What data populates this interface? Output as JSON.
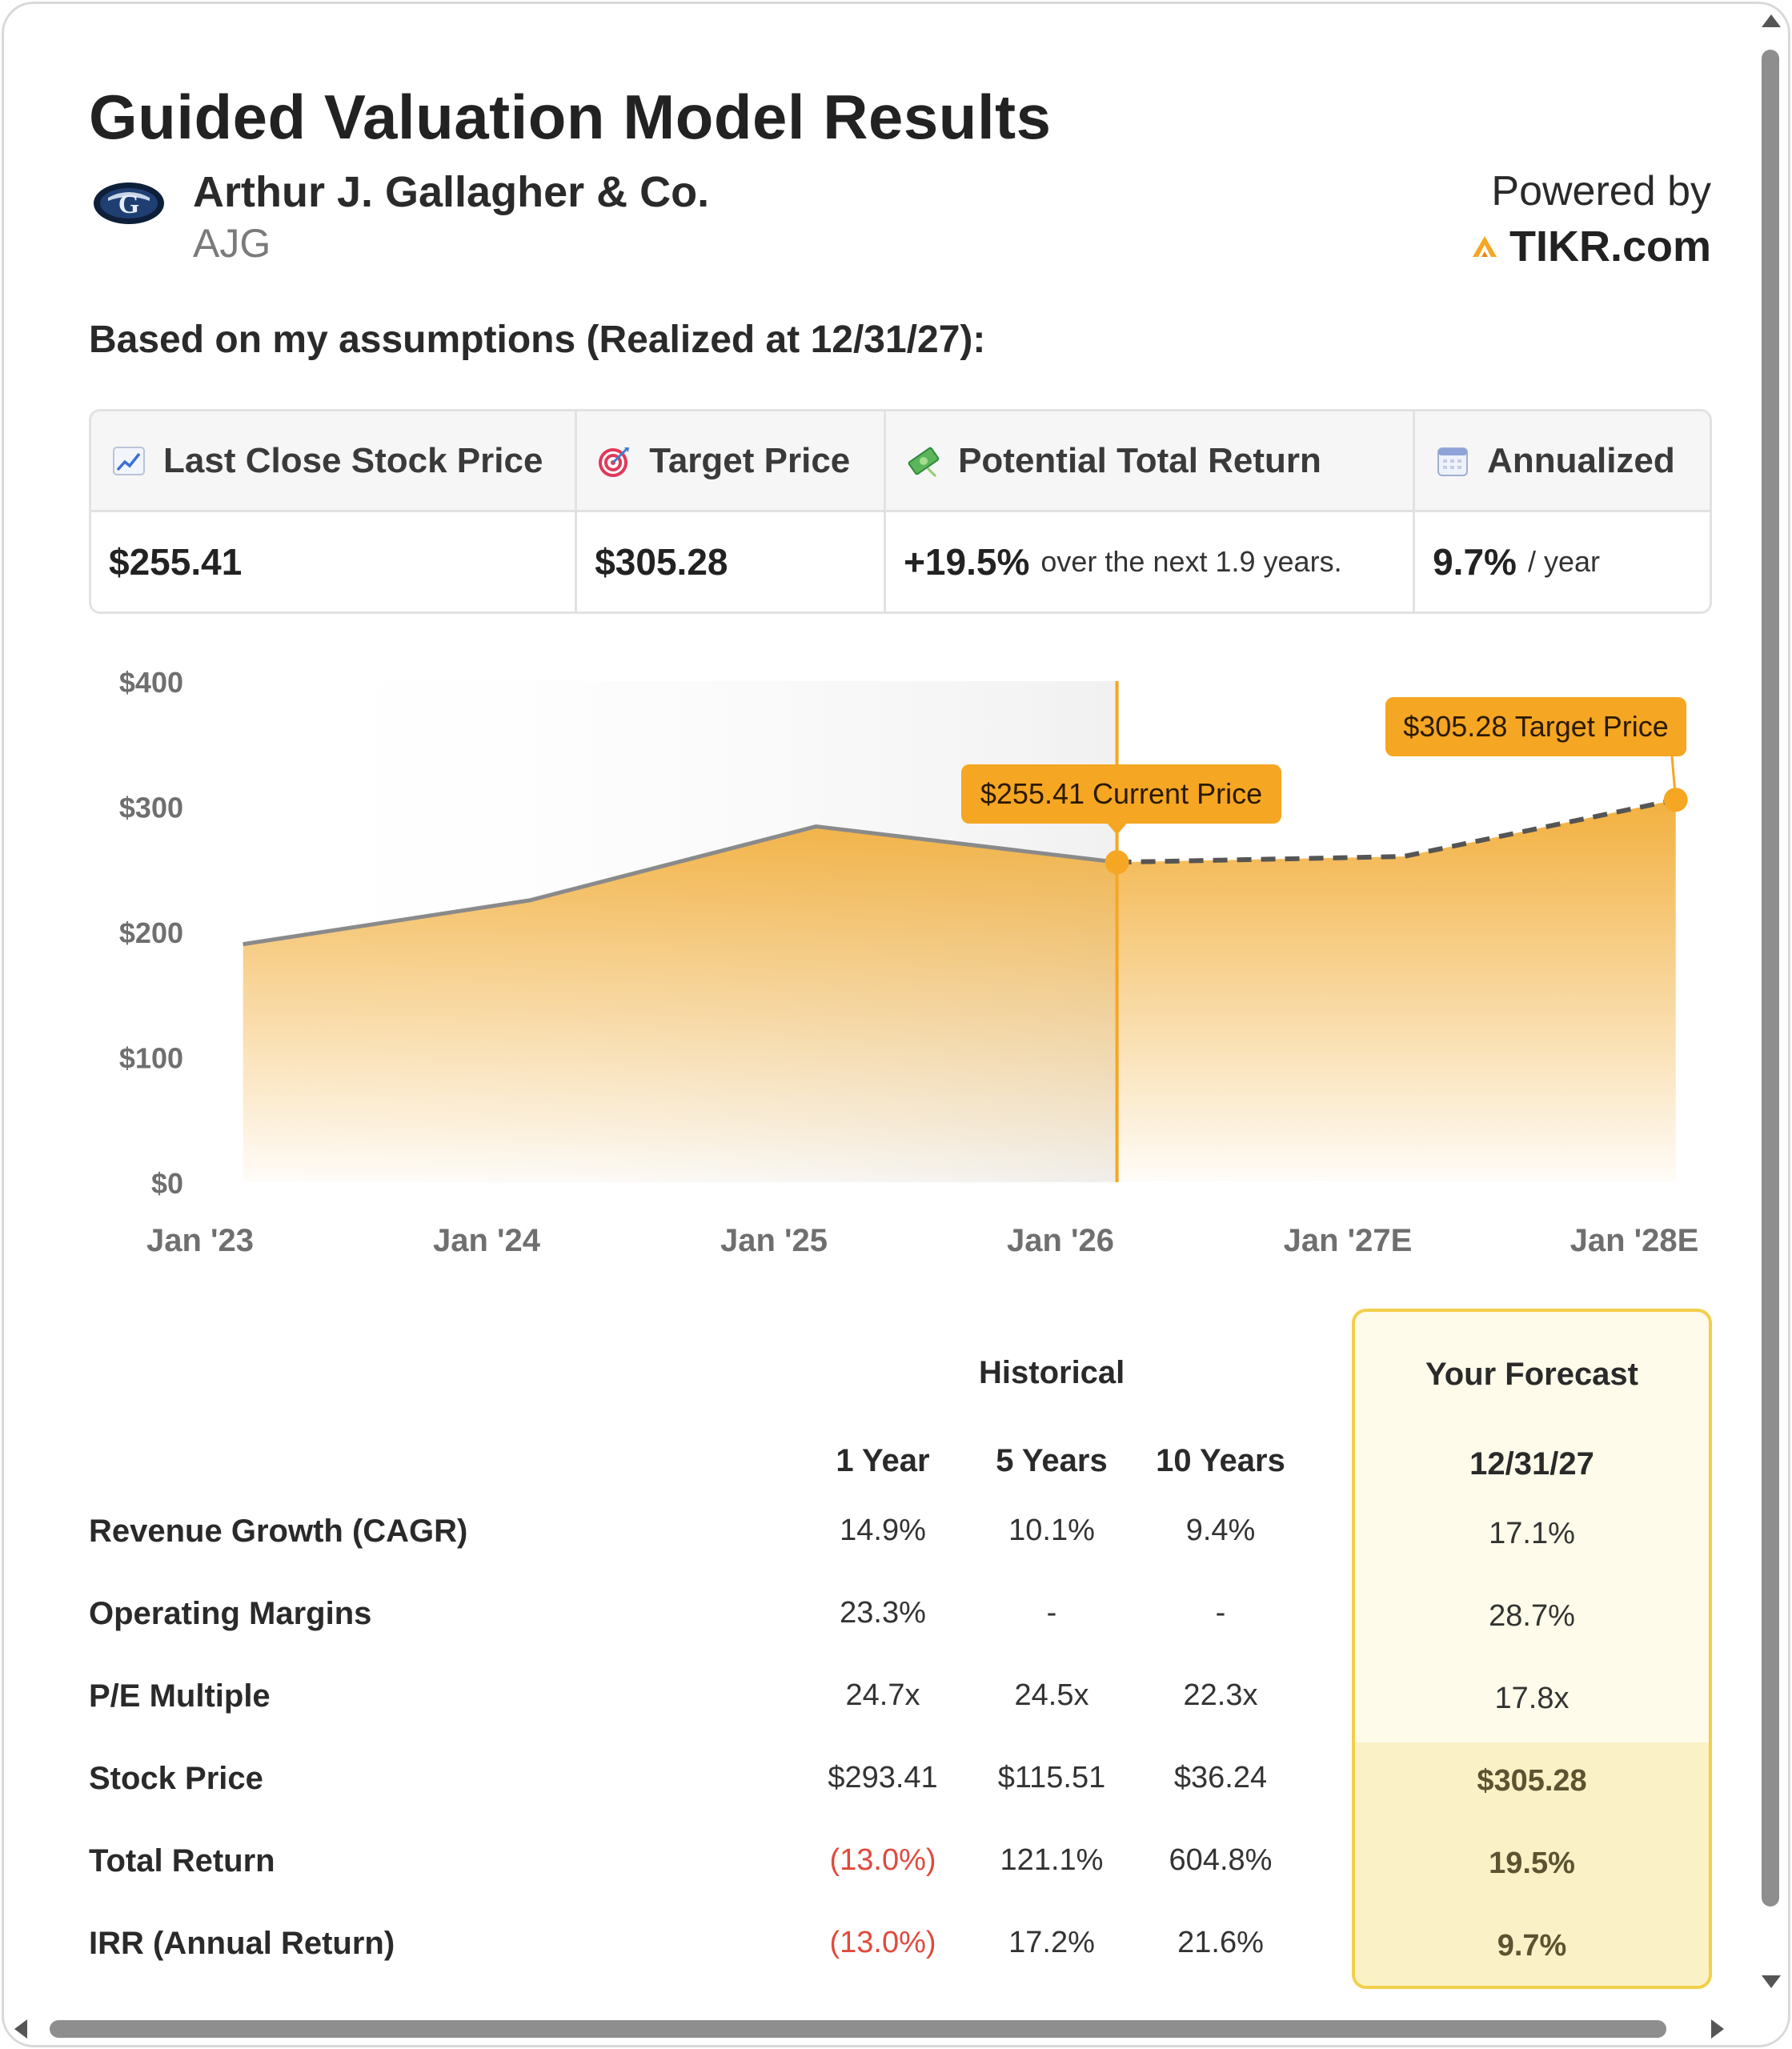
{
  "title": "Guided Valuation Model Results",
  "company": {
    "name": "Arthur J. Gallagher & Co.",
    "ticker": "AJG"
  },
  "powered_by": {
    "label": "Powered by",
    "brand": "TIKR.com"
  },
  "assumptions_label": "Based on my assumptions (Realized at 12/31/27):",
  "summary": {
    "last_close": {
      "icon": "chart-increasing-icon",
      "label": "Last Close Stock Price",
      "value": "$255.41"
    },
    "target": {
      "icon": "target-icon",
      "label": "Target Price",
      "value": "$305.28"
    },
    "potential": {
      "icon": "money-icon",
      "label": "Potential Total Return",
      "value": "+19.5%",
      "sub": "over the next 1.9 years."
    },
    "annualized": {
      "icon": "calendar-icon",
      "label": "Annualized",
      "value": "9.7%",
      "sub": "/ year"
    }
  },
  "chart_data": {
    "type": "area",
    "x": [
      "Jan '23",
      "Jan '24",
      "Jan '25",
      "Jan '26",
      "Jan '27E",
      "Jan '28E"
    ],
    "y_ticks": [
      "$400",
      "$300",
      "$200",
      "$100",
      "$0"
    ],
    "ylim": [
      0,
      400
    ],
    "historical": [
      {
        "x": 2023.15,
        "y": 190
      },
      {
        "x": 2024.15,
        "y": 225
      },
      {
        "x": 2025.15,
        "y": 284
      },
      {
        "x": 2026.2,
        "y": 255.41
      }
    ],
    "forecast": [
      {
        "x": 2026.2,
        "y": 255.41
      },
      {
        "x": 2027.2,
        "y": 260
      },
      {
        "x": 2028.15,
        "y": 305.28
      }
    ],
    "current_label": "$255.41 Current Price",
    "target_label": "$305.28 Target Price",
    "accent": "#f5a623",
    "line_color": "#8a8a8a"
  },
  "table": {
    "historical_label": "Historical",
    "forecast_label": "Your Forecast",
    "columns": [
      "1 Year",
      "5 Years",
      "10 Years"
    ],
    "forecast_date": "12/31/27",
    "rows": [
      {
        "label": "Revenue Growth (CAGR)",
        "values": [
          "14.9%",
          "10.1%",
          "9.4%"
        ],
        "forecast": "17.1%"
      },
      {
        "label": "Operating Margins",
        "values": [
          "23.3%",
          "-",
          "-"
        ],
        "forecast": "28.7%"
      },
      {
        "label": "P/E Multiple",
        "values": [
          "24.7x",
          "24.5x",
          "22.3x"
        ],
        "forecast": "17.8x"
      },
      {
        "label": "Stock Price",
        "values": [
          "$293.41",
          "$115.51",
          "$36.24"
        ],
        "forecast": "$305.28"
      },
      {
        "label": "Total Return",
        "values": [
          "(13.0%)",
          "121.1%",
          "604.8%"
        ],
        "forecast": "19.5%"
      },
      {
        "label": "IRR (Annual Return)",
        "values": [
          "(13.0%)",
          "17.2%",
          "21.6%"
        ],
        "forecast": "9.7%"
      }
    ]
  }
}
